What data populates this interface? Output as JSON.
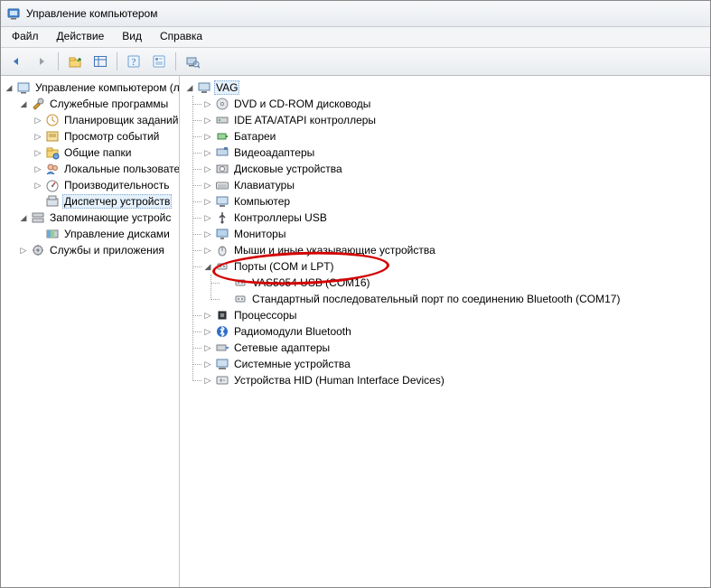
{
  "window": {
    "title": "Управление компьютером"
  },
  "menubar": [
    "Файл",
    "Действие",
    "Вид",
    "Справка"
  ],
  "toolbar": {
    "back": "back",
    "forward": "forward",
    "up": "up",
    "show_hide": "show-hide-tree",
    "properties": "properties",
    "help": "help",
    "refresh": "refresh"
  },
  "leftTree": {
    "root": "Управление компьютером (л",
    "systemTools": {
      "label": "Служебные программы",
      "items": [
        "Планировщик заданий",
        "Просмотр событий",
        "Общие папки",
        "Локальные пользовате",
        "Производительность",
        "Диспетчер устройств"
      ]
    },
    "storage": {
      "label": "Запоминающие устройс",
      "items": [
        "Управление дисками"
      ]
    },
    "services": {
      "label": "Службы и приложения"
    }
  },
  "rightTree": {
    "root": "VAG",
    "items": [
      "DVD и CD-ROM дисководы",
      "IDE ATA/ATAPI контроллеры",
      "Батареи",
      "Видеоадаптеры",
      "Дисковые устройства",
      "Клавиатуры",
      "Компьютер",
      "Контроллеры USB",
      "Мониторы",
      "Мыши и иные указывающие устройства"
    ],
    "ports": {
      "label": "Порты (COM и LPT)",
      "children": [
        "VAS5054 USB (COM16)",
        "Стандартный последовательный порт по соединению Bluetooth (COM17)"
      ]
    },
    "itemsAfter": [
      "Процессоры",
      "Радиомодули Bluetooth",
      "Сетевые адаптеры",
      "Системные устройства",
      "Устройства HID (Human Interface Devices)"
    ]
  }
}
